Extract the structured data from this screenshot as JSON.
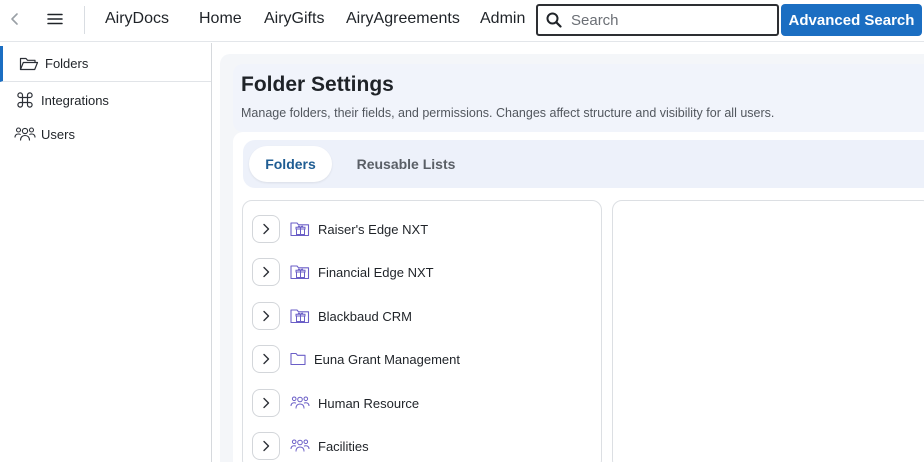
{
  "topbar": {
    "brand": "AiryDocs",
    "nav": [
      {
        "label": "Home"
      },
      {
        "label": "AiryGifts"
      },
      {
        "label": "AiryAgreements"
      },
      {
        "label": "Admin"
      }
    ],
    "search": {
      "placeholder": "Search",
      "value": ""
    },
    "advanced_search_label": "Advanced Search"
  },
  "sidebar": {
    "items": [
      {
        "label": "Folders",
        "icon": "folder-open-icon",
        "active": true
      },
      {
        "label": "Integrations",
        "icon": "command-icon",
        "active": false
      },
      {
        "label": "Users",
        "icon": "users-icon",
        "active": false
      }
    ]
  },
  "page": {
    "title": "Folder Settings",
    "description": "Manage folders, their fields, and permissions. Changes affect structure and visibility for all users."
  },
  "tabs": [
    {
      "label": "Folders",
      "active": true
    },
    {
      "label": "Reusable Lists",
      "active": false
    }
  ],
  "folders": [
    {
      "label": "Raiser's Edge NXT",
      "icon": "gift-folder-icon"
    },
    {
      "label": "Financial Edge NXT",
      "icon": "gift-folder-icon"
    },
    {
      "label": "Blackbaud CRM",
      "icon": "gift-folder-icon"
    },
    {
      "label": "Euna Grant Management",
      "icon": "folder-icon"
    },
    {
      "label": "Human Resource",
      "icon": "users-folder-icon"
    },
    {
      "label": "Facilities",
      "icon": "users-folder-icon"
    }
  ],
  "colors": {
    "accent": "#1b6ec2",
    "icon_purple": "#6b5fc7",
    "active_tab_text": "#1f5d93"
  }
}
